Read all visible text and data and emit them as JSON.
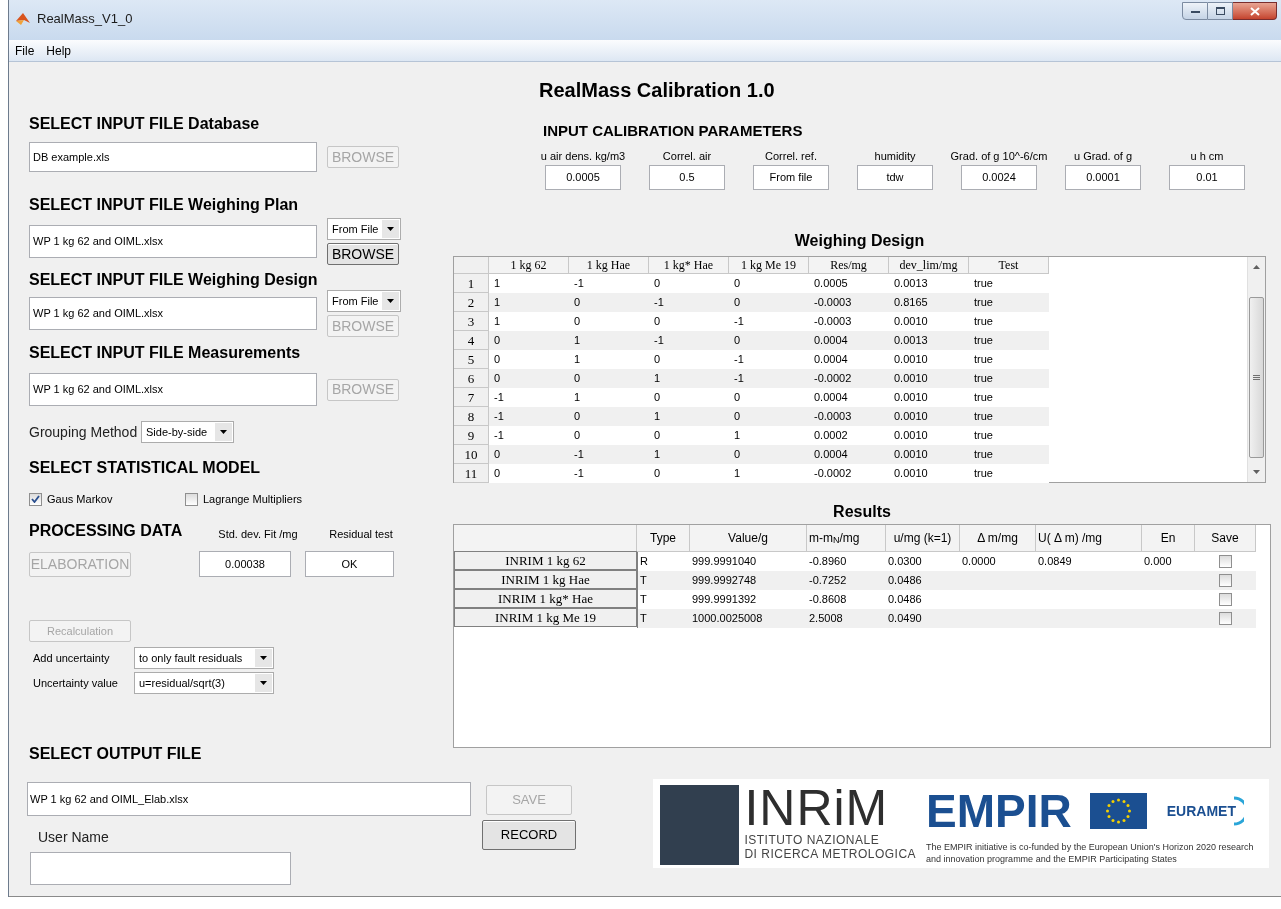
{
  "window": {
    "title": "RealMass_V1_0"
  },
  "menu": [
    {
      "label": "File"
    },
    {
      "label": "Help"
    }
  ],
  "app_title": "RealMass Calibration 1.0",
  "input_files": [
    {
      "heading": "SELECT INPUT FILE Database",
      "value": "DB example.xls",
      "browse": {
        "label": "BROWSE",
        "disabled": true
      }
    },
    {
      "heading": "SELECT INPUT FILE Weighing Plan",
      "value": "WP 1 kg 62 and OIML.xlsx",
      "source": "From File",
      "browse": {
        "label": "BROWSE",
        "disabled": false
      }
    },
    {
      "heading": "SELECT INPUT FILE Weighing Design",
      "value": "WP 1 kg 62 and OIML.xlsx",
      "source": "From File",
      "browse": {
        "label": "BROWSE",
        "disabled": true
      }
    },
    {
      "heading": "SELECT INPUT FILE Measurements",
      "value": "WP 1 kg 62 and OIML.xlsx",
      "browse": {
        "label": "BROWSE",
        "disabled": true
      }
    }
  ],
  "grouping": {
    "label": "Grouping Method",
    "value": "Side-by-side"
  },
  "statistical_model": {
    "heading": "SELECT STATISTICAL MODEL",
    "options": [
      {
        "label": "Gaus Markov",
        "checked": true
      },
      {
        "label": "Lagrange Multipliers",
        "checked": false
      }
    ]
  },
  "processing": {
    "heading": "PROCESSING DATA",
    "elaboration": {
      "label": "ELABORATION",
      "disabled": true
    },
    "std_dev": {
      "label": "Std. dev. Fit /mg",
      "value": "0.00038"
    },
    "residual_test": {
      "label": "Residual test",
      "value": "OK"
    },
    "recalculation": {
      "label": "Recalculation",
      "disabled": true
    },
    "add_uncertainty": {
      "label": "Add uncertainty",
      "value": "to only fault residuals"
    },
    "uncertainty_value": {
      "label": "Uncertainty value",
      "value": "u=residual/sqrt(3)"
    }
  },
  "output": {
    "heading": "SELECT OUTPUT FILE",
    "value": "WP 1 kg 62 and OIML_Elab.xlsx",
    "save": {
      "label": "SAVE",
      "disabled": true
    },
    "record": {
      "label": "RECORD",
      "disabled": false
    },
    "user_name_label": "User Name"
  },
  "calibration_parameters": {
    "heading": "INPUT CALIBRATION PARAMETERS",
    "fields": [
      {
        "label": "u air dens. kg/m3",
        "value": "0.0005"
      },
      {
        "label": "Correl. air",
        "value": "0.5"
      },
      {
        "label": "Correl. ref.",
        "value": "From file"
      },
      {
        "label": "humidity",
        "value": "tdw"
      },
      {
        "label": "Grad. of g 10^-6/cm",
        "value": "0.0024"
      },
      {
        "label": "u Grad. of g",
        "value": "0.0001"
      },
      {
        "label": "u h cm",
        "value": "0.01"
      }
    ]
  },
  "weighing_design": {
    "title": "Weighing Design",
    "columns": [
      "1 kg 62",
      "1 kg Hae",
      "1 kg* Hae",
      "1 kg Me 19",
      "Res/mg",
      "dev_lim/mg",
      "Test"
    ],
    "rows": [
      {
        "header": "1",
        "cells": [
          "1",
          "-1",
          "0",
          "0",
          "0.0005",
          "0.0013",
          "true"
        ]
      },
      {
        "header": "2",
        "cells": [
          "1",
          "0",
          "-1",
          "0",
          "-0.0003",
          "0.8165",
          "true"
        ]
      },
      {
        "header": "3",
        "cells": [
          "1",
          "0",
          "0",
          "-1",
          "-0.0003",
          "0.0010",
          "true"
        ]
      },
      {
        "header": "4",
        "cells": [
          "0",
          "1",
          "-1",
          "0",
          "0.0004",
          "0.0013",
          "true"
        ]
      },
      {
        "header": "5",
        "cells": [
          "0",
          "1",
          "0",
          "-1",
          "0.0004",
          "0.0010",
          "true"
        ]
      },
      {
        "header": "6",
        "cells": [
          "0",
          "0",
          "1",
          "-1",
          "-0.0002",
          "0.0010",
          "true"
        ]
      },
      {
        "header": "7",
        "cells": [
          "-1",
          "1",
          "0",
          "0",
          "0.0004",
          "0.0010",
          "true"
        ]
      },
      {
        "header": "8",
        "cells": [
          "-1",
          "0",
          "1",
          "0",
          "-0.0003",
          "0.0010",
          "true"
        ]
      },
      {
        "header": "9",
        "cells": [
          "-1",
          "0",
          "0",
          "1",
          "0.0002",
          "0.0010",
          "true"
        ]
      },
      {
        "header": "10",
        "cells": [
          "0",
          "-1",
          "1",
          "0",
          "0.0004",
          "0.0010",
          "true"
        ]
      },
      {
        "header": "11",
        "cells": [
          "0",
          "-1",
          "0",
          "1",
          "-0.0002",
          "0.0010",
          "true"
        ]
      }
    ]
  },
  "results": {
    "title": "Results",
    "columns": [
      "Type",
      "Value/g",
      "m-m$_{N}$/mg",
      "u/mg (k=1)",
      "Δ m/mg",
      "U( Δ m) /mg",
      "En",
      "Save"
    ],
    "rows": [
      {
        "name": "INRIM 1 kg 62",
        "cells": [
          "R",
          "999.9991040",
          "-0.8960",
          "0.0300",
          "0.0000",
          "0.0849",
          "0.000"
        ],
        "save": false
      },
      {
        "name": "INRIM 1 kg Hae",
        "cells": [
          "T",
          "999.9992748",
          "-0.7252",
          "0.0486"
        ],
        "save": false
      },
      {
        "name": "INRIM 1 kg* Hae",
        "cells": [
          "T",
          "999.9991392",
          "-0.8608",
          "0.0486"
        ],
        "save": false
      },
      {
        "name": "INRIM 1 kg Me 19",
        "cells": [
          "T",
          "1000.0025008",
          "2.5008",
          "0.0490"
        ],
        "save": false
      }
    ]
  },
  "logos": {
    "inrim": {
      "name": "INRiM",
      "lines": [
        "ISTITUTO NAZIONALE",
        "DI RICERCA METROLOGICA"
      ]
    },
    "empir": {
      "name": "EMPIR",
      "caption": "The EMPIR initiative is co-funded by the European Union's Horizon 2020 research and innovation programme and the EMPIR Participating States"
    },
    "euramet": {
      "name": "EURAMET"
    }
  }
}
